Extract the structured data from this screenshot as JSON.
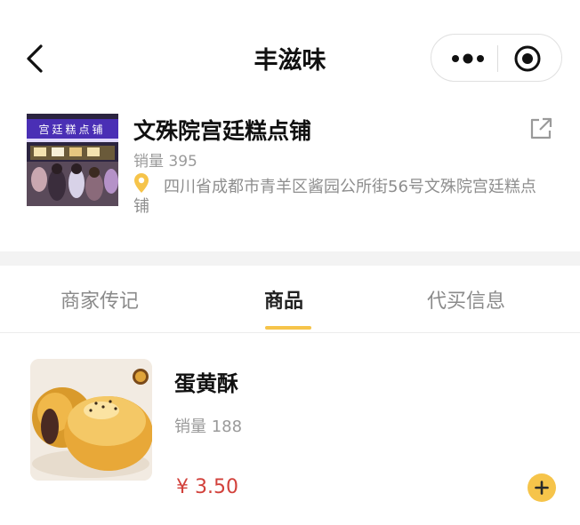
{
  "nav": {
    "title": "丰滋味",
    "back_icon": "chevron-left-icon",
    "more_icon": "more-dots-icon",
    "close_icon": "target-circle-icon"
  },
  "shop": {
    "name": "文殊院宫廷糕点铺",
    "sales": "销量 395",
    "address": "四川省成都市青羊区酱园公所街56号文殊院宫廷糕点铺",
    "sign_text": "宫廷糕点铺",
    "share_icon": "external-link-icon",
    "location_icon": "location-pin-icon"
  },
  "tabs": [
    {
      "label": "商家传记",
      "active": false
    },
    {
      "label": "商品",
      "active": true
    },
    {
      "label": "代买信息",
      "active": false
    }
  ],
  "product": {
    "name": "蛋黄酥",
    "sales": "销量 188",
    "price": "¥ 3.50",
    "add_icon": "plus-icon"
  },
  "colors": {
    "accent": "#f6c44a",
    "price": "#d2413b",
    "muted": "#9a9a9a"
  }
}
